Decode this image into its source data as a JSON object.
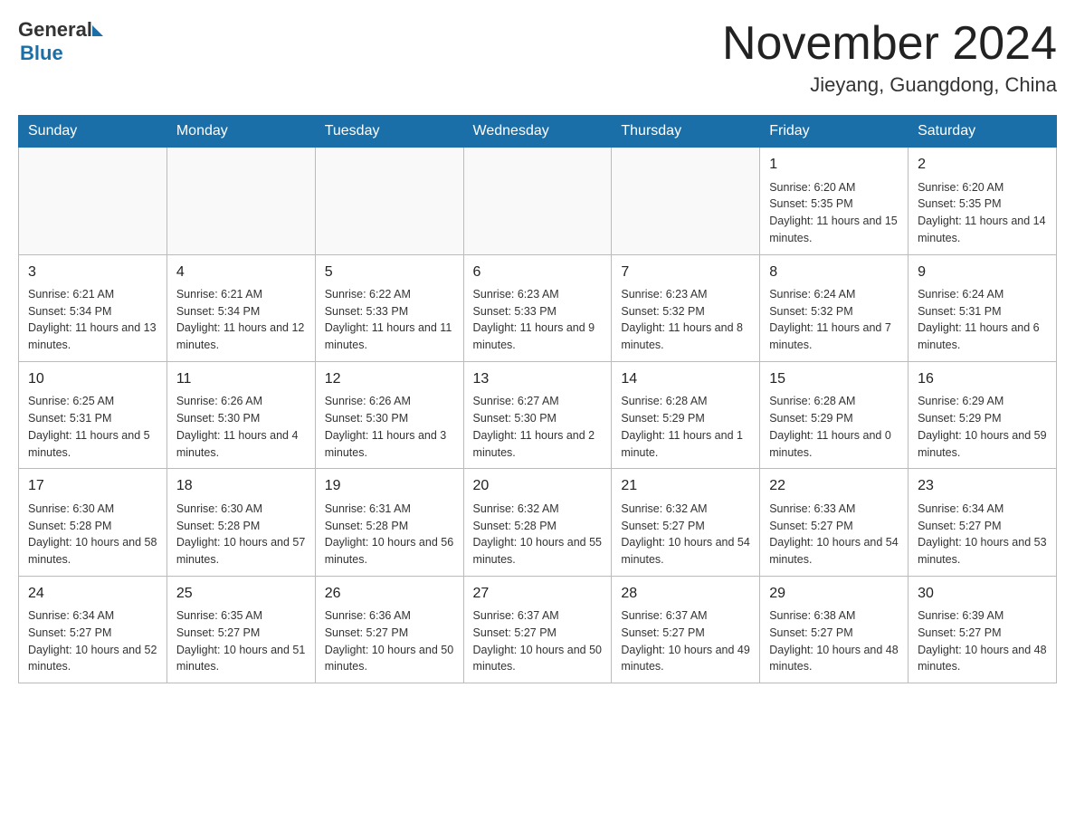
{
  "header": {
    "logo_general": "General",
    "logo_blue": "Blue",
    "month_title": "November 2024",
    "location": "Jieyang, Guangdong, China"
  },
  "weekdays": [
    "Sunday",
    "Monday",
    "Tuesday",
    "Wednesday",
    "Thursday",
    "Friday",
    "Saturday"
  ],
  "weeks": [
    [
      {
        "day": "",
        "info": ""
      },
      {
        "day": "",
        "info": ""
      },
      {
        "day": "",
        "info": ""
      },
      {
        "day": "",
        "info": ""
      },
      {
        "day": "",
        "info": ""
      },
      {
        "day": "1",
        "info": "Sunrise: 6:20 AM\nSunset: 5:35 PM\nDaylight: 11 hours and 15 minutes."
      },
      {
        "day": "2",
        "info": "Sunrise: 6:20 AM\nSunset: 5:35 PM\nDaylight: 11 hours and 14 minutes."
      }
    ],
    [
      {
        "day": "3",
        "info": "Sunrise: 6:21 AM\nSunset: 5:34 PM\nDaylight: 11 hours and 13 minutes."
      },
      {
        "day": "4",
        "info": "Sunrise: 6:21 AM\nSunset: 5:34 PM\nDaylight: 11 hours and 12 minutes."
      },
      {
        "day": "5",
        "info": "Sunrise: 6:22 AM\nSunset: 5:33 PM\nDaylight: 11 hours and 11 minutes."
      },
      {
        "day": "6",
        "info": "Sunrise: 6:23 AM\nSunset: 5:33 PM\nDaylight: 11 hours and 9 minutes."
      },
      {
        "day": "7",
        "info": "Sunrise: 6:23 AM\nSunset: 5:32 PM\nDaylight: 11 hours and 8 minutes."
      },
      {
        "day": "8",
        "info": "Sunrise: 6:24 AM\nSunset: 5:32 PM\nDaylight: 11 hours and 7 minutes."
      },
      {
        "day": "9",
        "info": "Sunrise: 6:24 AM\nSunset: 5:31 PM\nDaylight: 11 hours and 6 minutes."
      }
    ],
    [
      {
        "day": "10",
        "info": "Sunrise: 6:25 AM\nSunset: 5:31 PM\nDaylight: 11 hours and 5 minutes."
      },
      {
        "day": "11",
        "info": "Sunrise: 6:26 AM\nSunset: 5:30 PM\nDaylight: 11 hours and 4 minutes."
      },
      {
        "day": "12",
        "info": "Sunrise: 6:26 AM\nSunset: 5:30 PM\nDaylight: 11 hours and 3 minutes."
      },
      {
        "day": "13",
        "info": "Sunrise: 6:27 AM\nSunset: 5:30 PM\nDaylight: 11 hours and 2 minutes."
      },
      {
        "day": "14",
        "info": "Sunrise: 6:28 AM\nSunset: 5:29 PM\nDaylight: 11 hours and 1 minute."
      },
      {
        "day": "15",
        "info": "Sunrise: 6:28 AM\nSunset: 5:29 PM\nDaylight: 11 hours and 0 minutes."
      },
      {
        "day": "16",
        "info": "Sunrise: 6:29 AM\nSunset: 5:29 PM\nDaylight: 10 hours and 59 minutes."
      }
    ],
    [
      {
        "day": "17",
        "info": "Sunrise: 6:30 AM\nSunset: 5:28 PM\nDaylight: 10 hours and 58 minutes."
      },
      {
        "day": "18",
        "info": "Sunrise: 6:30 AM\nSunset: 5:28 PM\nDaylight: 10 hours and 57 minutes."
      },
      {
        "day": "19",
        "info": "Sunrise: 6:31 AM\nSunset: 5:28 PM\nDaylight: 10 hours and 56 minutes."
      },
      {
        "day": "20",
        "info": "Sunrise: 6:32 AM\nSunset: 5:28 PM\nDaylight: 10 hours and 55 minutes."
      },
      {
        "day": "21",
        "info": "Sunrise: 6:32 AM\nSunset: 5:27 PM\nDaylight: 10 hours and 54 minutes."
      },
      {
        "day": "22",
        "info": "Sunrise: 6:33 AM\nSunset: 5:27 PM\nDaylight: 10 hours and 54 minutes."
      },
      {
        "day": "23",
        "info": "Sunrise: 6:34 AM\nSunset: 5:27 PM\nDaylight: 10 hours and 53 minutes."
      }
    ],
    [
      {
        "day": "24",
        "info": "Sunrise: 6:34 AM\nSunset: 5:27 PM\nDaylight: 10 hours and 52 minutes."
      },
      {
        "day": "25",
        "info": "Sunrise: 6:35 AM\nSunset: 5:27 PM\nDaylight: 10 hours and 51 minutes."
      },
      {
        "day": "26",
        "info": "Sunrise: 6:36 AM\nSunset: 5:27 PM\nDaylight: 10 hours and 50 minutes."
      },
      {
        "day": "27",
        "info": "Sunrise: 6:37 AM\nSunset: 5:27 PM\nDaylight: 10 hours and 50 minutes."
      },
      {
        "day": "28",
        "info": "Sunrise: 6:37 AM\nSunset: 5:27 PM\nDaylight: 10 hours and 49 minutes."
      },
      {
        "day": "29",
        "info": "Sunrise: 6:38 AM\nSunset: 5:27 PM\nDaylight: 10 hours and 48 minutes."
      },
      {
        "day": "30",
        "info": "Sunrise: 6:39 AM\nSunset: 5:27 PM\nDaylight: 10 hours and 48 minutes."
      }
    ]
  ]
}
